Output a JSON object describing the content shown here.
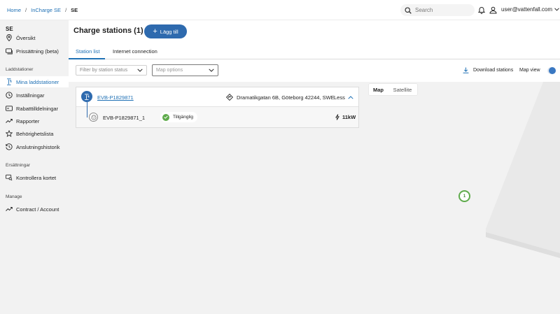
{
  "breadcrumb": {
    "home": "Home",
    "incharge": "InCharge SE",
    "current": "SE",
    "separator": "/"
  },
  "header": {
    "search_placeholder": "Search",
    "user_email": "user@vattenfall.com"
  },
  "sidebar": {
    "title": "SE",
    "items_top": [
      {
        "label": "Översikt",
        "icon": "location-pin-icon"
      },
      {
        "label": "Prissättning (beta)",
        "icon": "price-tag-icon"
      }
    ],
    "section_laddstationer": "Laddstationer",
    "items_laddstationer": [
      {
        "label": "Mina laddstationer",
        "icon": "charger-icon",
        "active": true
      },
      {
        "label": "Inställningar",
        "icon": "clock-icon"
      },
      {
        "label": "Rabatttilldelningar",
        "icon": "card-icon"
      },
      {
        "label": "Rapporter",
        "icon": "trend-icon"
      },
      {
        "label": "Behörighetslista",
        "icon": "star-icon"
      },
      {
        "label": "Anslutningshistorik",
        "icon": "history-icon"
      }
    ],
    "section_ersattningar": "Ersättningar",
    "items_ersattningar": [
      {
        "label": "Kontrollera kortet",
        "icon": "card-search-icon"
      }
    ],
    "section_manage": "Manage",
    "items_manage": [
      {
        "label": "Contract / Account",
        "icon": "trend-icon"
      }
    ]
  },
  "main": {
    "title": "Charge stations (1)",
    "add_button": "Lägg till",
    "tabs": [
      {
        "label": "Station list",
        "active": true
      },
      {
        "label": "Internet connection",
        "active": false
      }
    ],
    "filter_placeholder": "Filter by station status",
    "map_options_placeholder": "Map options",
    "download_label": "Download stations",
    "map_view_label": "Map view",
    "map_view_on": true
  },
  "station": {
    "id": "EVB-P1829871",
    "address": "Dramatikgatan 6B, Göteborg 42244, SWE",
    "less_label": "Less",
    "connector": {
      "id": "EVB-P1829871_1",
      "status": "Tillgänglig",
      "power": "11kW"
    }
  },
  "map": {
    "tab_map": "Map",
    "tab_satellite": "Satellite",
    "marker_count": "1"
  },
  "colors": {
    "accent": "#2071b5",
    "button": "#2e6aae",
    "available": "#5fab4c"
  }
}
